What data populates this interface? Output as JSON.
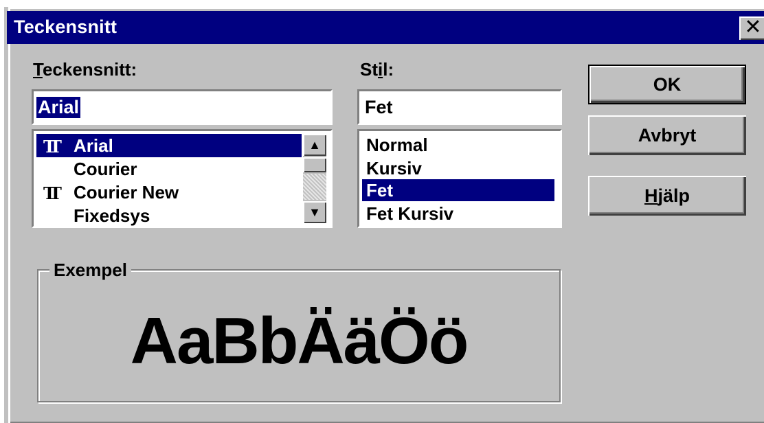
{
  "dialog": {
    "title": "Teckensnitt",
    "close_symbol": "✕"
  },
  "font_section": {
    "label_underlined": "T",
    "label_rest": "eckensnitt:",
    "input_value": "Arial",
    "items": [
      {
        "label": "Arial",
        "icon": "truetype-icon",
        "selected": true
      },
      {
        "label": "Courier",
        "icon": "",
        "selected": false
      },
      {
        "label": "Courier New",
        "icon": "truetype-icon",
        "selected": false
      },
      {
        "label": "Fixedsys",
        "icon": "",
        "selected": false
      }
    ]
  },
  "style_section": {
    "label_before": "St",
    "label_underlined": "i",
    "label_after": "l:",
    "input_value": "Fet",
    "items": [
      {
        "label": "Normal",
        "selected": false
      },
      {
        "label": "Kursiv",
        "selected": false
      },
      {
        "label": "Fet",
        "selected": true
      },
      {
        "label": "Fet Kursiv",
        "selected": false
      }
    ]
  },
  "buttons": {
    "ok": "OK",
    "cancel": "Avbryt",
    "help_underlined": "H",
    "help_rest": "jälp"
  },
  "sample": {
    "group_label": "Exempel",
    "text": "AaBbÄäÖö"
  },
  "icons": {
    "truetype_glyph": "TT",
    "scroll_up": "▲",
    "scroll_down": "▼"
  },
  "colors": {
    "title_bar": "#000080",
    "dialog_bg": "#c0c0c0",
    "selection": "#000080"
  }
}
